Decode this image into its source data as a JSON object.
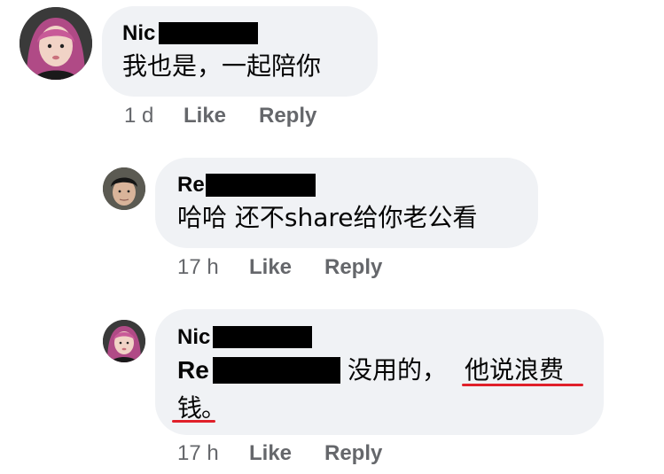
{
  "comments": [
    {
      "author": "Nic",
      "text": "我也是，一起陪你",
      "time": "1 d",
      "like": "Like",
      "reply": "Reply"
    },
    {
      "author": "Re",
      "text": "哈哈 还不share给你老公看",
      "time": "17 h",
      "like": "Like",
      "reply": "Reply"
    },
    {
      "author": "Nic",
      "mention": "Re",
      "text_part1": "没用的，",
      "text_part2": "他说浪费",
      "text_part3": "钱",
      "text_part4": "。",
      "time": "17 h",
      "like": "Like",
      "reply": "Reply"
    }
  ],
  "colors": {
    "bubble": "#f0f2f5",
    "meta_text": "#65676b",
    "underline": "#e0202a",
    "redaction": "#000000"
  }
}
